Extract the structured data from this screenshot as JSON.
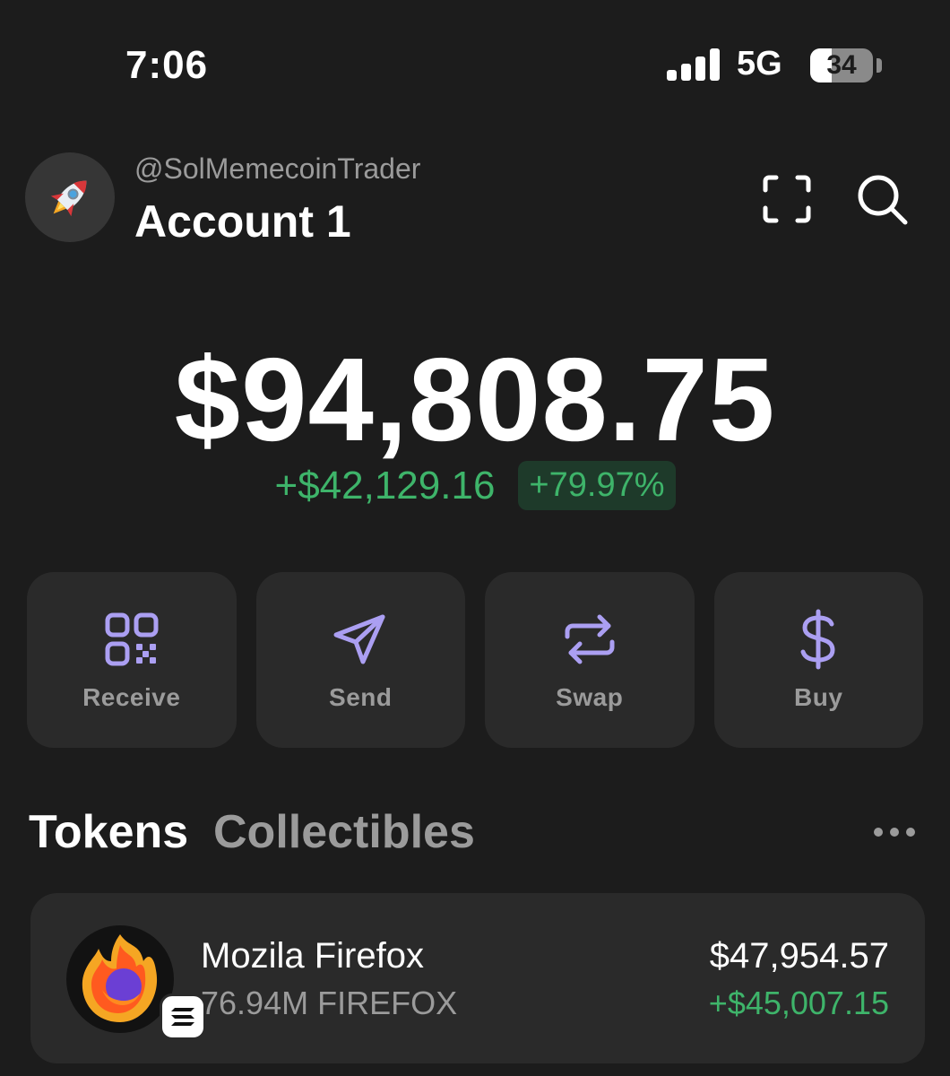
{
  "status_bar": {
    "time": "7:06",
    "network": "5G",
    "battery_level": "34"
  },
  "account": {
    "handle": "@SolMemecoinTrader",
    "name": "Account 1",
    "avatar_icon": "rocket-icon"
  },
  "balance": {
    "total": "$94,808.75",
    "change_amount": "+$42,129.16",
    "change_percent": "+79.97%"
  },
  "actions": [
    {
      "label": "Receive",
      "icon": "qr-code-icon"
    },
    {
      "label": "Send",
      "icon": "send-icon"
    },
    {
      "label": "Swap",
      "icon": "swap-icon"
    },
    {
      "label": "Buy",
      "icon": "dollar-icon"
    }
  ],
  "tabs": {
    "tokens": "Tokens",
    "collectibles": "Collectibles"
  },
  "tokens": [
    {
      "name": "Mozila Firefox",
      "amount": "76.94M FIREFOX",
      "value": "$47,954.57",
      "change": "+$45,007.15"
    }
  ],
  "colors": {
    "background": "#1c1c1c",
    "card": "#2a2a2a",
    "accent_purple": "#ab9ff2",
    "positive_green": "#3eb46a",
    "muted_text": "#9b9b9b"
  }
}
